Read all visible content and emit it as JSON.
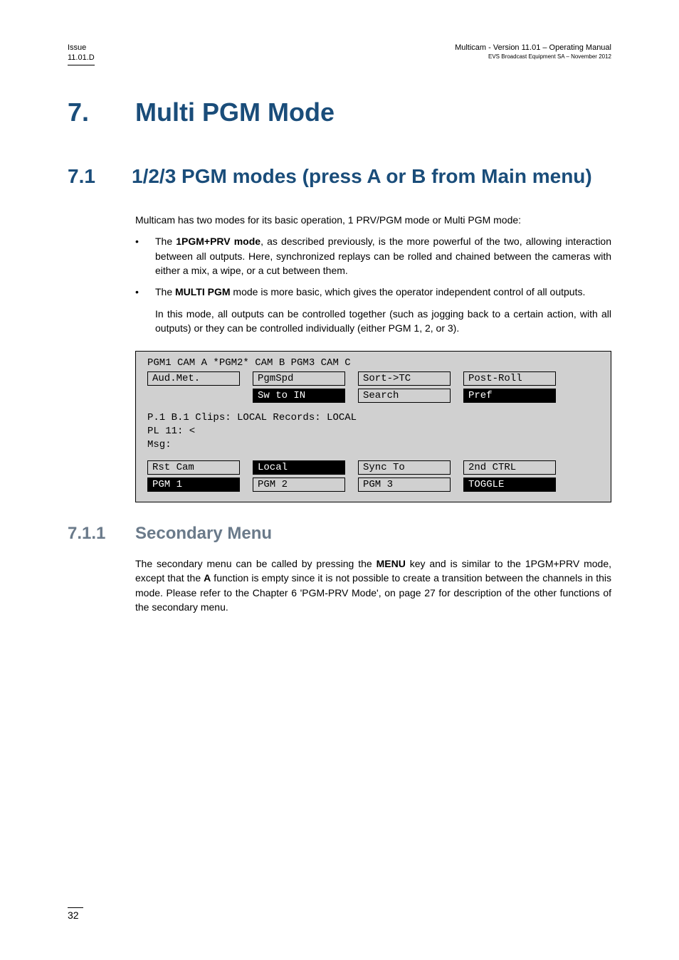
{
  "header": {
    "issue_label": "Issue",
    "issue_value": "11.01.D",
    "right_line1": "Multicam - Version 11.01 – Operating Manual",
    "right_line2": "EVS Broadcast Equipment SA – November 2012"
  },
  "chapter": {
    "number": "7.",
    "title": "Multi PGM Mode"
  },
  "section": {
    "number": "7.1",
    "title": "1/2/3 PGM modes (press A or B from Main menu)"
  },
  "intro": "Multicam has two modes for its basic operation, 1 PRV/PGM mode or Multi PGM mode:",
  "bullets": {
    "b1a": "The ",
    "b1b": "1PGM+PRV mode",
    "b1c": ", as described previously, is the more powerful of the two, allowing interaction between all outputs. Here, synchronized replays can be rolled and chained between the cameras with either a mix, a wipe, or a cut between them.",
    "b2a": "The ",
    "b2b": "MULTI PGM",
    "b2c": " mode is more basic, which gives the operator independent control of all outputs.",
    "b2sub": "In this mode, all outputs can be controlled together (such as jogging back to a certain action, with all outputs) or they can be controlled individually (either PGM 1, 2, or 3)."
  },
  "terminal": {
    "header": "PGM1 CAM A  *PGM2* CAM B  PGM3 CAM C",
    "row1": [
      "Aud.Met.",
      "PgmSpd",
      "Sort->TC",
      "Post-Roll"
    ],
    "row2_blank": "",
    "row2": [
      "",
      "Sw to IN",
      "Search",
      "Pref"
    ],
    "mid1": "P.1   B.1  Clips: LOCAL Records: LOCAL",
    "mid2": "PL 11: <",
    "mid3": "Msg:",
    "row3": [
      "Rst Cam",
      "Local",
      "Sync To",
      "2nd CTRL"
    ],
    "row4": [
      "PGM 1",
      "PGM 2",
      "PGM 3",
      "TOGGLE"
    ]
  },
  "subsection": {
    "number": "7.1.1",
    "title": "Secondary Menu"
  },
  "sub_para": {
    "a": "The secondary menu can be called by pressing the ",
    "b": "MENU",
    "c": " key and is similar to the 1PGM+PRV mode, except that the ",
    "d": "A",
    "e": " function is empty since it is not possible to create a transition between the channels in this mode. Please refer to the Chapter 6 'PGM-PRV Mode', on page 27 for description of the other functions of the secondary menu."
  },
  "page_number": "32"
}
